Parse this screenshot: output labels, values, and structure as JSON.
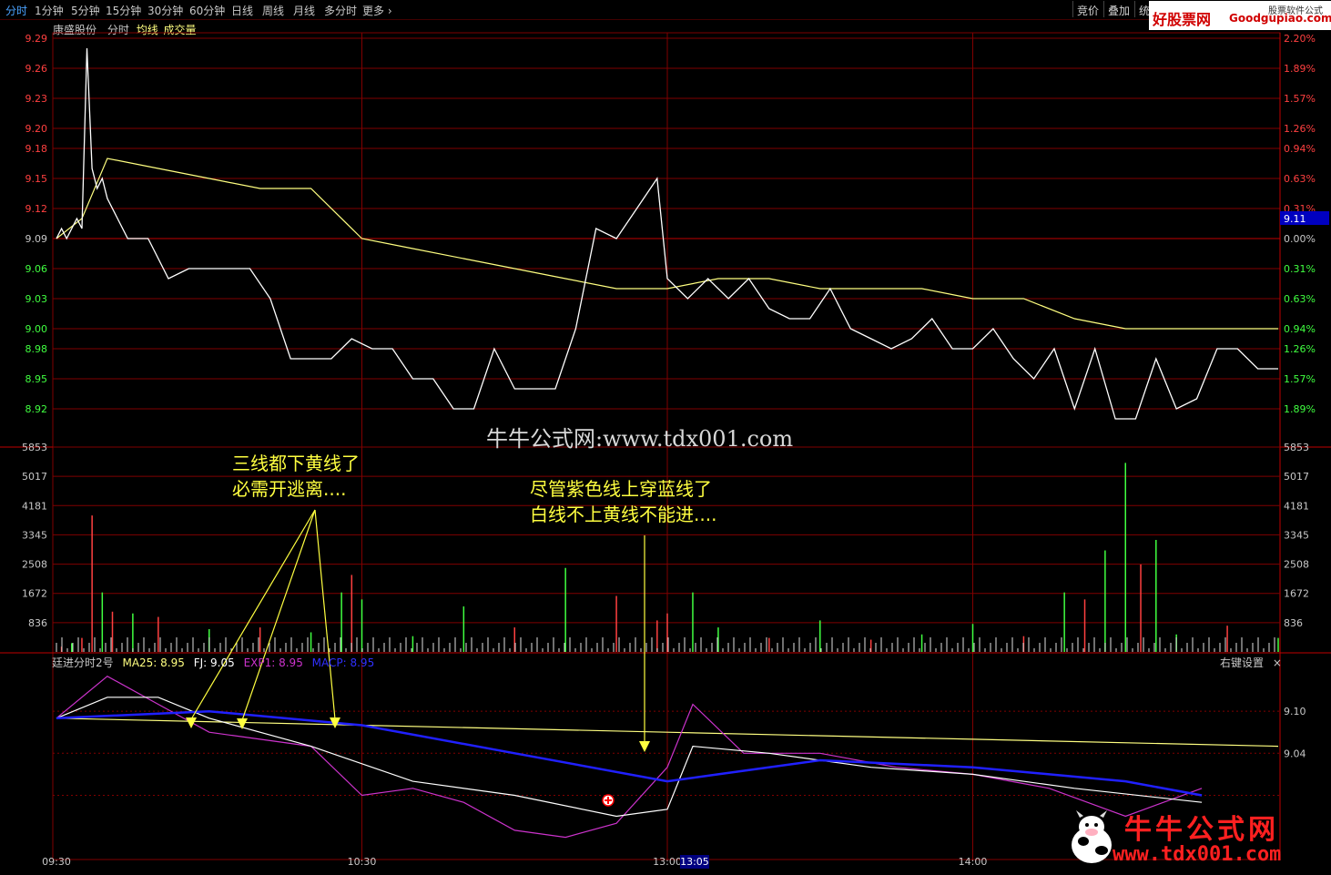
{
  "toolbar": {
    "tabs": [
      "分时",
      "1分钟",
      "5分钟",
      "15分钟",
      "30分钟",
      "60分钟",
      "日线",
      "周线",
      "月线",
      "多分时",
      "更多"
    ],
    "right_buttons": [
      "竞价",
      "叠加",
      "统"
    ],
    "brand": {
      "name": "好股票网",
      "domain": "Goodgupiao.com",
      "tag": "股票软件公式"
    }
  },
  "header": {
    "stock": "康盛股份",
    "mode": "分时",
    "avg_label": "均线",
    "vol_label": "成交量"
  },
  "watermark": {
    "center": "牛牛公式网:www.tdx001.com",
    "brand_cn": "牛牛公式网",
    "brand_url": "www.tdx001.com"
  },
  "annotations": [
    {
      "line1": "三线都下黄线了",
      "line2": "必需开逃离...."
    },
    {
      "line1": "尽管紫色线上穿蓝线了",
      "line2": "白线不上黄线不能进...."
    }
  ],
  "indicator": {
    "name": "廷进分时2号",
    "ma25": "MA25: 8.95",
    "fj": "FJ: 9.05",
    "exp1": "EXP1: 8.95",
    "macp": "MACP: 8.95",
    "right_label": "右键设置",
    "close": "×",
    "y_labels": [
      "9.10",
      "9.04"
    ]
  },
  "colors": {
    "price": "#ffffff",
    "avg": "#ffff80",
    "up": "#ff4040",
    "down": "#40ff40",
    "grid": "#800000",
    "exp1": "#cc33cc",
    "macp": "#2020ff",
    "fj": "#ffffff",
    "ma25": "#ffff80"
  },
  "chart_data": [
    {
      "type": "line",
      "title": "",
      "series": [
        {
          "name": "分时",
          "x": [
            "09:30",
            "09:31",
            "09:32",
            "09:33",
            "09:34",
            "09:35",
            "09:36",
            "09:37",
            "09:38",
            "09:39",
            "09:40",
            "09:44",
            "09:48",
            "09:52",
            "09:56",
            "10:00",
            "10:04",
            "10:08",
            "10:12",
            "10:16",
            "10:20",
            "10:24",
            "10:28",
            "10:32",
            "10:36",
            "10:40",
            "10:44",
            "10:48",
            "10:52",
            "10:56",
            "11:00",
            "11:04",
            "11:08",
            "11:12",
            "11:16",
            "11:20",
            "11:24",
            "11:28",
            "13:00",
            "13:04",
            "13:08",
            "13:12",
            "13:16",
            "13:20",
            "13:24",
            "13:28",
            "13:32",
            "13:36",
            "13:40",
            "13:44",
            "13:48",
            "13:52",
            "13:56",
            "14:00",
            "14:04",
            "14:08",
            "14:12",
            "14:16",
            "14:20",
            "14:24",
            "14:28",
            "14:32",
            "14:36",
            "14:40",
            "14:44",
            "14:48",
            "14:52",
            "14:56",
            "15:00"
          ],
          "y": [
            9.09,
            9.1,
            9.09,
            9.1,
            9.11,
            9.1,
            9.28,
            9.16,
            9.14,
            9.15,
            9.13,
            9.09,
            9.09,
            9.05,
            9.06,
            9.06,
            9.06,
            9.06,
            9.03,
            8.97,
            8.97,
            8.97,
            8.99,
            8.98,
            8.98,
            8.95,
            8.95,
            8.92,
            8.92,
            8.98,
            8.94,
            8.94,
            8.94,
            9.0,
            9.1,
            9.09,
            9.12,
            9.15,
            9.05,
            9.03,
            9.05,
            9.03,
            9.05,
            9.02,
            9.01,
            9.01,
            9.04,
            9.0,
            8.99,
            8.98,
            8.99,
            9.01,
            8.98,
            8.98,
            9.0,
            8.97,
            8.95,
            8.98,
            8.92,
            8.98,
            8.91,
            8.91,
            8.97,
            8.92,
            8.93,
            8.98,
            8.98,
            8.96,
            8.96
          ]
        },
        {
          "name": "均线",
          "x": [
            "09:30",
            "09:35",
            "09:40",
            "09:50",
            "10:00",
            "10:10",
            "10:20",
            "10:30",
            "10:40",
            "10:50",
            "11:00",
            "11:10",
            "11:20",
            "11:30",
            "13:10",
            "13:20",
            "13:30",
            "13:40",
            "13:50",
            "14:00",
            "14:10",
            "14:20",
            "14:30",
            "14:40",
            "14:50",
            "15:00"
          ],
          "y": [
            9.09,
            9.11,
            9.17,
            9.16,
            9.15,
            9.14,
            9.14,
            9.09,
            9.08,
            9.07,
            9.06,
            9.05,
            9.04,
            9.04,
            9.05,
            9.05,
            9.04,
            9.04,
            9.04,
            9.03,
            9.03,
            9.01,
            9.0,
            9.0,
            9.0,
            9.0
          ]
        }
      ],
      "y_ticks": [
        "9.29",
        "9.26",
        "9.23",
        "9.20",
        "9.18",
        "9.15",
        "9.12",
        "9.09",
        "9.06",
        "9.03",
        "9.00",
        "8.98",
        "8.95",
        "8.92"
      ],
      "pct_ticks": [
        "2.20%",
        "1.89%",
        "1.57%",
        "1.26%",
        "0.94%",
        "0.63%",
        "0.31%",
        "0.00%",
        "0.31%",
        "0.63%",
        "0.94%",
        "1.26%",
        "1.57%",
        "1.89%"
      ],
      "ylim": [
        8.91,
        9.29
      ],
      "x_ticks": [
        "09:30",
        "10:30",
        "13:00",
        "14:00"
      ],
      "current_price": "9.11",
      "cursor_time": "13:05",
      "grid": true
    },
    {
      "type": "bar",
      "title": "",
      "y_ticks": [
        "5853",
        "5017",
        "4181",
        "3345",
        "2508",
        "1672",
        "836"
      ],
      "ylim": [
        0,
        5853
      ],
      "series": [
        {
          "name": "成交量",
          "x": [
            "09:31",
            "09:33",
            "09:35",
            "09:37",
            "09:39",
            "09:41",
            "09:45",
            "09:50",
            "10:00",
            "10:10",
            "10:20",
            "10:26",
            "10:28",
            "10:30",
            "10:40",
            "10:50",
            "11:00",
            "11:10",
            "11:20",
            "11:28",
            "13:00",
            "13:05",
            "13:10",
            "13:20",
            "13:30",
            "13:40",
            "13:50",
            "14:00",
            "14:10",
            "14:18",
            "14:22",
            "14:26",
            "14:30",
            "14:33",
            "14:36",
            "14:40",
            "14:50",
            "15:00"
          ],
          "values": [
            150,
            250,
            400,
            3900,
            1700,
            1150,
            1100,
            1000,
            650,
            700,
            560,
            1700,
            2200,
            1500,
            450,
            1300,
            700,
            2400,
            1600,
            900,
            1100,
            1700,
            700,
            400,
            900,
            350,
            500,
            800,
            450,
            1700,
            1500,
            2900,
            5400,
            2500,
            3200,
            500,
            750,
            400
          ],
          "up": [
            true,
            false,
            true,
            true,
            false,
            true,
            false,
            true,
            false,
            true,
            false,
            false,
            true,
            false,
            false,
            false,
            true,
            false,
            true,
            true,
            true,
            false,
            false,
            true,
            false,
            true,
            false,
            false,
            true,
            false,
            true,
            false,
            false,
            true,
            false,
            false,
            true,
            false
          ]
        }
      ]
    },
    {
      "type": "line",
      "title": "",
      "y_ticks": [
        "9.10",
        "9.04"
      ],
      "series": [
        {
          "name": "EXP1",
          "x": [
            "09:30",
            "09:40",
            "09:50",
            "10:00",
            "10:10",
            "10:20",
            "10:30",
            "10:40",
            "10:50",
            "11:00",
            "11:10",
            "11:20",
            "11:30",
            "13:05",
            "13:15",
            "13:30",
            "13:45",
            "14:00",
            "14:15",
            "14:30",
            "14:45"
          ],
          "y": [
            9.09,
            9.15,
            9.11,
            9.07,
            9.06,
            9.05,
            8.98,
            8.99,
            8.97,
            8.93,
            8.92,
            8.94,
            9.02,
            9.11,
            9.04,
            9.04,
            9.02,
            9.01,
            8.99,
            8.95,
            8.99
          ]
        },
        {
          "name": "MACP",
          "x": [
            "09:30",
            "10:00",
            "10:30",
            "11:00",
            "11:30",
            "13:10",
            "13:30",
            "14:00",
            "14:30",
            "14:45"
          ],
          "y": [
            9.09,
            9.1,
            9.08,
            9.04,
            9.0,
            9.01,
            9.03,
            9.02,
            9.0,
            8.98
          ]
        },
        {
          "name": "FJ",
          "x": [
            "09:30",
            "09:40",
            "09:50",
            "10:00",
            "10:20",
            "10:40",
            "11:00",
            "11:20",
            "11:30",
            "13:05",
            "13:20",
            "13:40",
            "14:00",
            "14:20",
            "14:45"
          ],
          "y": [
            9.09,
            9.12,
            9.12,
            9.09,
            9.05,
            9.0,
            8.98,
            8.95,
            8.96,
            9.05,
            9.04,
            9.02,
            9.01,
            8.99,
            8.97
          ]
        },
        {
          "name": "MA25",
          "x": [
            "09:30",
            "10:30",
            "13:00",
            "14:00",
            "15:00"
          ],
          "y": [
            9.09,
            9.08,
            9.07,
            9.06,
            9.05
          ]
        }
      ]
    }
  ]
}
